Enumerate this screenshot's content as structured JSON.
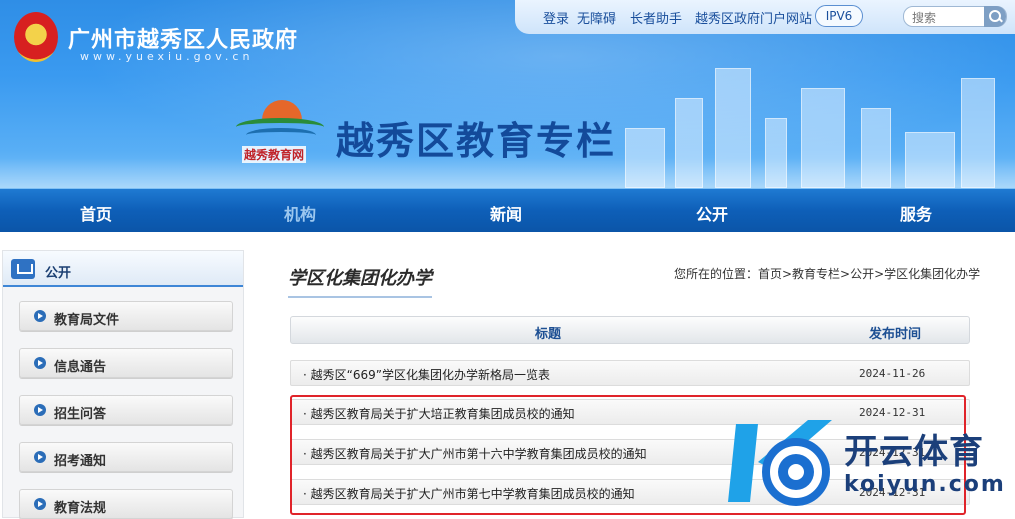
{
  "header": {
    "gov_title": "广州市越秀区人民政府",
    "gov_url": "www.yuexiu.gov.cn",
    "site_logo_caption": "越秀教育网",
    "site_title": "越秀区教育专栏",
    "topbar": {
      "links": [
        "登录",
        "无障碍",
        "长者助手",
        "越秀区政府门户网站"
      ],
      "ipv6": "IPV6",
      "search_placeholder": "搜索"
    },
    "colors": {
      "banner": "#3a9af0",
      "title": "#134a9a"
    }
  },
  "nav": {
    "items": [
      "首页",
      "机构",
      "新闻",
      "公开",
      "服务"
    ],
    "active_dim": "机构"
  },
  "sidebar": {
    "heading": "公开",
    "items": [
      "教育局文件",
      "信息通告",
      "招生问答",
      "招考通知",
      "教育法规"
    ]
  },
  "main": {
    "section_title": "学区化集团化办学",
    "breadcrumb": "您所在的位置：首页>教育专栏>公开>学区化集团化办学",
    "table": {
      "headers": [
        "标题",
        "发布时间"
      ],
      "rows": [
        {
          "title": "· 越秀区“669”学区化集团化办学新格局一览表",
          "date": "2024-11-26"
        },
        {
          "title": "· 越秀区教育局关于扩大培正教育集团成员校的通知",
          "date": "2024-12-31"
        },
        {
          "title": "· 越秀区教育局关于扩大广州市第十六中学教育集团成员校的通知",
          "date": "2024-12-31"
        },
        {
          "title": "· 越秀区教育局关于扩大广州市第七中学教育集团成员校的通知",
          "date": "2024-12-31"
        }
      ]
    },
    "highlight_color": "#e0242a"
  },
  "watermark": {
    "brand": "开云体育",
    "url": "koiyun.com"
  }
}
